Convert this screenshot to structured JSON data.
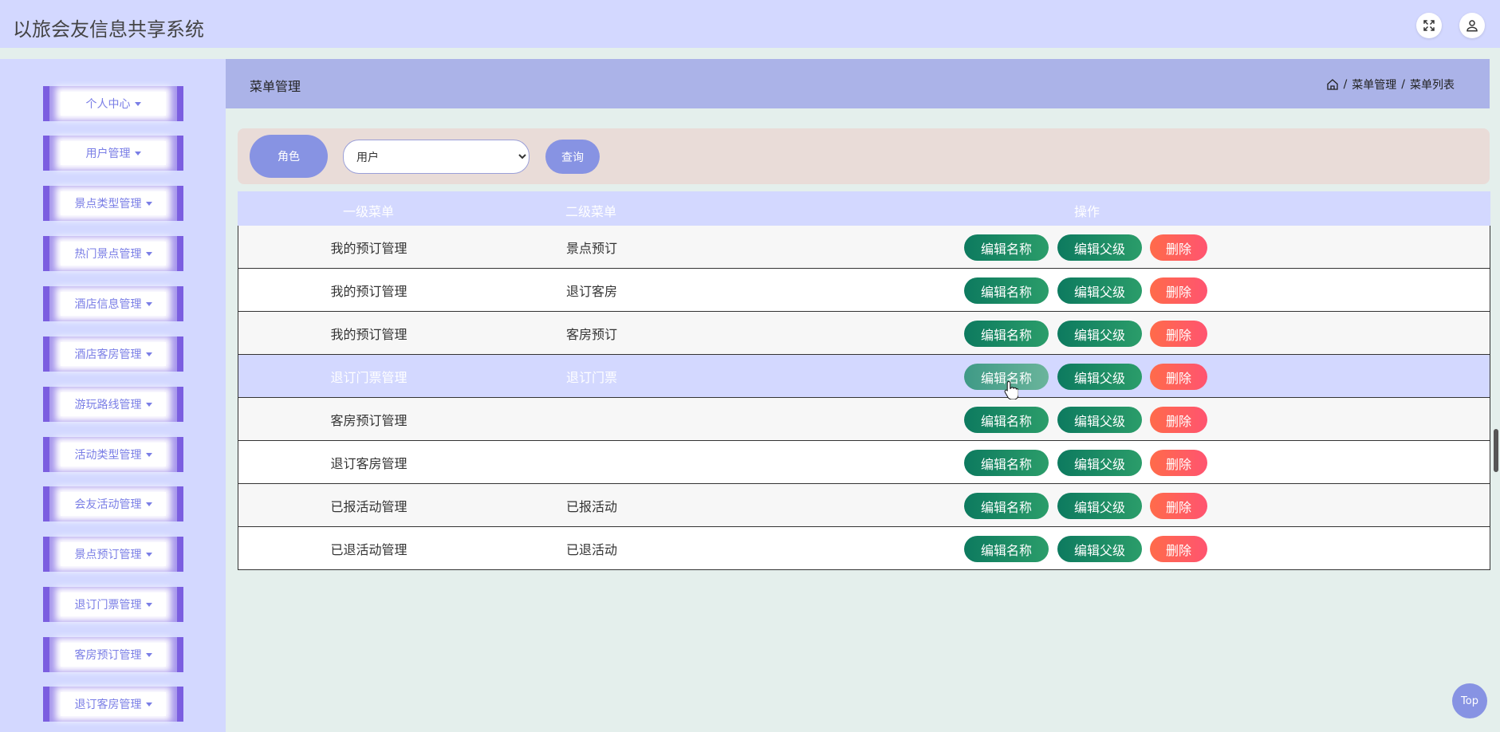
{
  "app": {
    "title": "以旅会友信息共享系统"
  },
  "header_icons": [
    "fullscreen-icon",
    "user-icon"
  ],
  "sidebar": {
    "items": [
      {
        "label": "个人中心"
      },
      {
        "label": "用户管理"
      },
      {
        "label": "景点类型管理"
      },
      {
        "label": "热门景点管理"
      },
      {
        "label": "酒店信息管理"
      },
      {
        "label": "酒店客房管理"
      },
      {
        "label": "游玩路线管理"
      },
      {
        "label": "活动类型管理"
      },
      {
        "label": "会友活动管理"
      },
      {
        "label": "景点预订管理"
      },
      {
        "label": "退订门票管理"
      },
      {
        "label": "客房预订管理"
      },
      {
        "label": "退订客房管理"
      }
    ]
  },
  "page": {
    "title": "菜单管理",
    "breadcrumb": [
      "菜单管理",
      "菜单列表"
    ],
    "separator": "/"
  },
  "search": {
    "role_label": "角色",
    "role_value": "用户",
    "role_options": [
      "用户"
    ],
    "query_label": "查询"
  },
  "table": {
    "headers": [
      "一级菜单",
      "二级菜单",
      "操作"
    ],
    "actions": {
      "edit_name": "编辑名称",
      "edit_parent": "编辑父级",
      "delete": "删除"
    },
    "rows": [
      {
        "level1": "我的预订管理",
        "level2": "景点预订"
      },
      {
        "level1": "我的预订管理",
        "level2": "退订客房"
      },
      {
        "level1": "我的预订管理",
        "level2": "客房预订"
      },
      {
        "level1": "退订门票管理",
        "level2": "退订门票",
        "highlighted": true
      },
      {
        "level1": "客房预订管理",
        "level2": ""
      },
      {
        "level1": "退订客房管理",
        "level2": ""
      },
      {
        "level1": "已报活动管理",
        "level2": "已报活动"
      },
      {
        "level1": "已退活动管理",
        "level2": "已退活动"
      }
    ]
  },
  "back_to_top": "Top",
  "colors": {
    "header_bg": "#d3d8ff",
    "accent": "#8793e3",
    "sidebar_border": "#7b5ee0",
    "btn_green": "#0d7a5f",
    "btn_red": "#ff5d5d"
  }
}
